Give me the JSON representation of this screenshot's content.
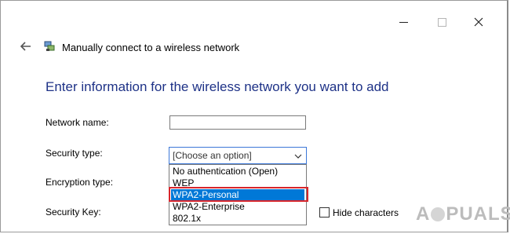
{
  "window": {
    "title_bar_buttons": [
      "minimize-icon",
      "maximize-icon",
      "close-icon"
    ]
  },
  "nav": {
    "back_icon": "arrow-left-icon",
    "network_icon": "network-icon"
  },
  "wizard": {
    "title": "Manually connect to a wireless network",
    "instruction": "Enter information for the wireless network you want to add"
  },
  "form": {
    "network_name_label": "Network name:",
    "network_name_value": "",
    "security_type_label": "Security type:",
    "security_type_value": "[Choose an option]",
    "encryption_type_label": "Encryption type:",
    "security_key_label": "Security Key:",
    "hide_characters_label": "Hide characters",
    "hide_characters_checked": false
  },
  "dropdown": {
    "options": [
      "No authentication (Open)",
      "WEP",
      "WPA2-Personal",
      "WPA2-Enterprise",
      "802.1x"
    ],
    "highlighted": "WPA2-Personal"
  },
  "watermark": {
    "text_left": "A",
    "text_right": "PUALS"
  },
  "colors": {
    "instruction": "#1e3287",
    "selection": "#0078d7",
    "highlight_border": "#d8262c"
  }
}
